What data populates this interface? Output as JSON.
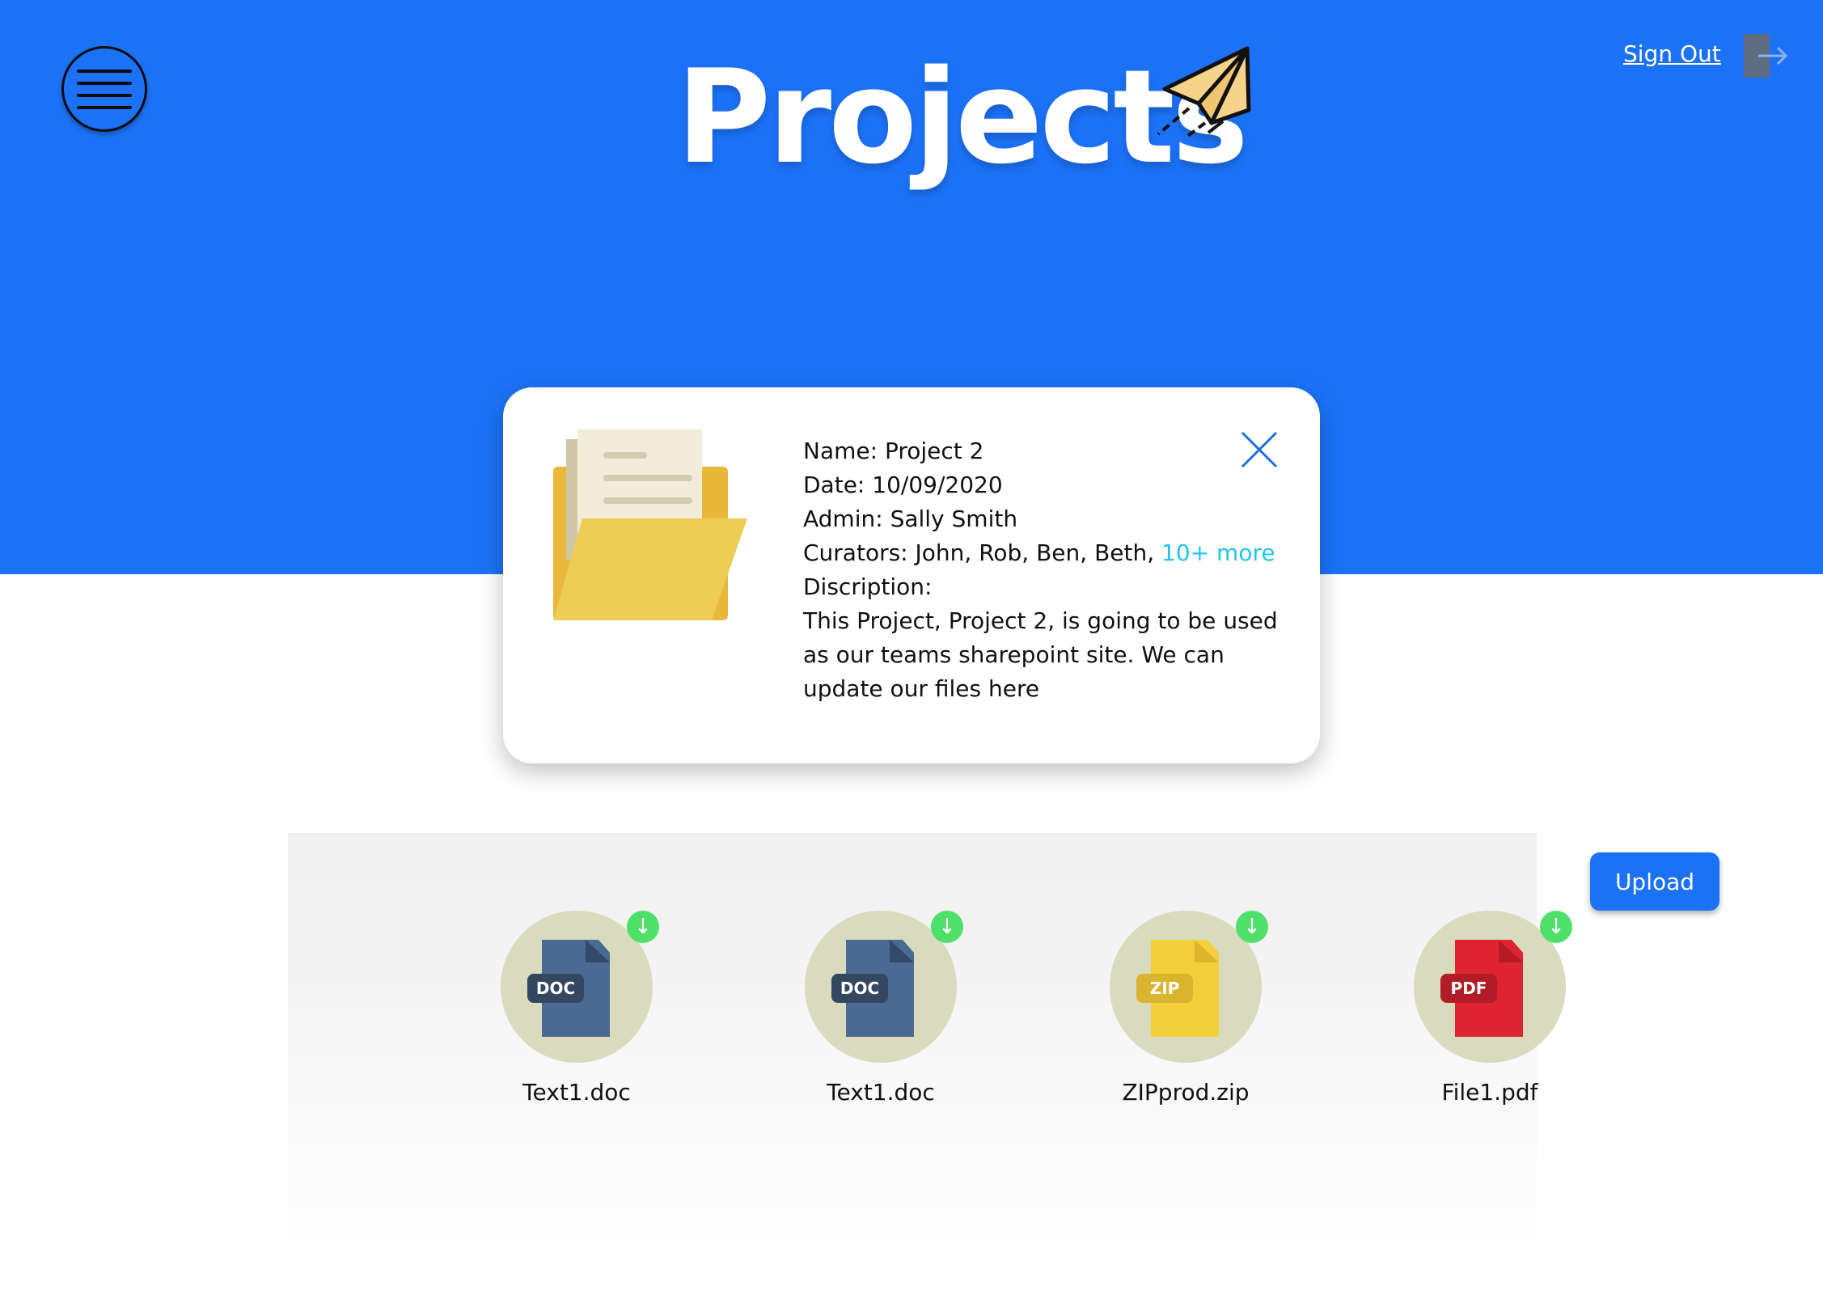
{
  "header": {
    "title": "Projects",
    "sign_out_label": "Sign Out",
    "background_color": "#1c72f7",
    "icons": [
      "menu-icon",
      "paper-plane-icon",
      "sign-out-icon"
    ]
  },
  "project": {
    "name_line": "Name: Project 2",
    "date_line": "Date: 10/09/2020",
    "admin_line": "Admin: Sally Smith",
    "curators_prefix": "Curators: John, Rob, Ben, Beth, ",
    "curators_more": "10+ more",
    "description_label": "Discription:",
    "description_text": "This Project, Project 2, is going to be used as our teams sharepoint site. We can update our files here",
    "icons": [
      "folder-icon",
      "close-icon"
    ]
  },
  "files": {
    "items": [
      {
        "name": "Text1.doc",
        "type_label": "DOC",
        "color": "#4a6993"
      },
      {
        "name": "Text1.doc",
        "type_label": "DOC",
        "color": "#4a6993"
      },
      {
        "name": "ZIPprod.zip",
        "type_label": "ZIP",
        "color": "#f4cf3c"
      },
      {
        "name": "File1.pdf",
        "type_label": "PDF",
        "color": "#de2430"
      }
    ],
    "download_glyph": "↓",
    "upload_label": "Upload"
  }
}
